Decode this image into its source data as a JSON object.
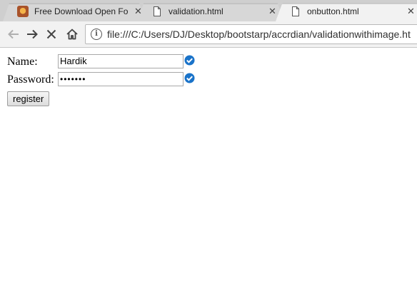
{
  "browser": {
    "tabs": [
      {
        "title": "Free Download Open Fo",
        "close": "✕",
        "favicon": "app-icon"
      },
      {
        "title": "validation.html",
        "close": "✕",
        "favicon": "document-icon"
      },
      {
        "title": "onbutton.html",
        "close": "✕",
        "favicon": "document-icon"
      }
    ],
    "address_bar": {
      "url": "file:///C:/Users/DJ/Desktop/bootstarp/accrdian/validationwithimage.ht",
      "info_glyph": "i"
    }
  },
  "form": {
    "name_label": "Name:",
    "name_value": "Hardik",
    "password_label": "Password:",
    "password_value": "•••••••",
    "register_label": "register",
    "check_color": "#1a73c9"
  }
}
